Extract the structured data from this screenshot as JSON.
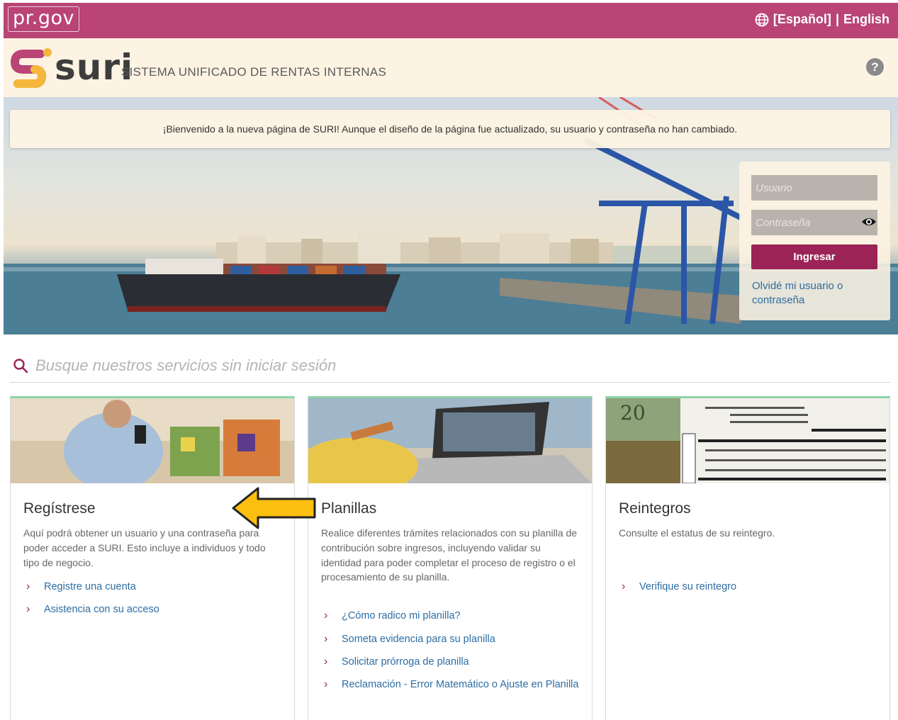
{
  "topbar": {
    "site": "pr.gov",
    "lang_current": "[Español]",
    "lang_sep": "|",
    "lang_alt": "English"
  },
  "header": {
    "logo_text": "suri",
    "subtitle": "SISTEMA UNIFICADO DE RENTAS INTERNAS",
    "help": "?"
  },
  "notice": "¡Bienvenido a la nueva página de SURI! Aunque el diseño de la página fue actualizado, su usuario y contraseña no han cambiado.",
  "login": {
    "user_placeholder": "Usuario",
    "pass_placeholder": "Contraseña",
    "submit": "Ingresar",
    "forgot": "Olvidé mi usuario o contraseña"
  },
  "search": {
    "placeholder": "Busque nuestros servicios sin iniciar sesión"
  },
  "cards": [
    {
      "title": "Regístrese",
      "desc": "Aquí podrá obtener un usuario y una contraseña para poder acceder a SURI. Esto incluye a individuos y todo tipo de negocio.",
      "links": [
        "Registre una cuenta",
        "Asistencia con su acceso"
      ]
    },
    {
      "title": "Planillas",
      "desc": "Realice diferentes trámites relacionados con su planilla de contribución sobre ingresos, incluyendo validar su identidad para poder completar el proceso de registro o el procesamiento de su planilla.",
      "links": [
        "¿Cómo radico mi planilla?",
        "Someta evidencia para su planilla",
        "Solicitar prórroga de planilla",
        "Reclamación - Error Matemático o Ajuste en Planilla"
      ]
    },
    {
      "title": "Reintegros",
      "desc": "Consulte el estatus de su reintegro.",
      "links": [
        "Verifique su reintegro"
      ]
    }
  ],
  "colors": {
    "brand": "#b94475",
    "button": "#9c2357",
    "link": "#2d6da3",
    "header_bg": "#fdf3e3",
    "card_accent": "#8fd3a8",
    "arrow": "#fbbf0f"
  },
  "icons": [
    "globe-icon",
    "help-icon",
    "eye-icon",
    "search-icon",
    "chevron-right-icon",
    "arrow-left-icon"
  ]
}
